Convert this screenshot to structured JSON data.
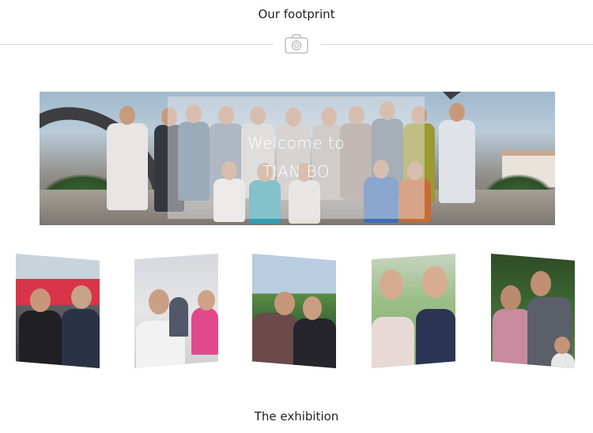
{
  "footprint": {
    "title": "Our footprint",
    "divider_icon": "camera-icon"
  },
  "banner": {
    "welcome_line1": "Welcome to",
    "welcome_line2": "TIAN BO"
  },
  "gallery": {
    "photos": [
      {
        "name": "photo-two-men-suits"
      },
      {
        "name": "photo-office-desk"
      },
      {
        "name": "photo-men-outdoors"
      },
      {
        "name": "photo-two-women"
      },
      {
        "name": "photo-group-garden"
      }
    ]
  },
  "exhibition": {
    "title": "The exhibition"
  }
}
